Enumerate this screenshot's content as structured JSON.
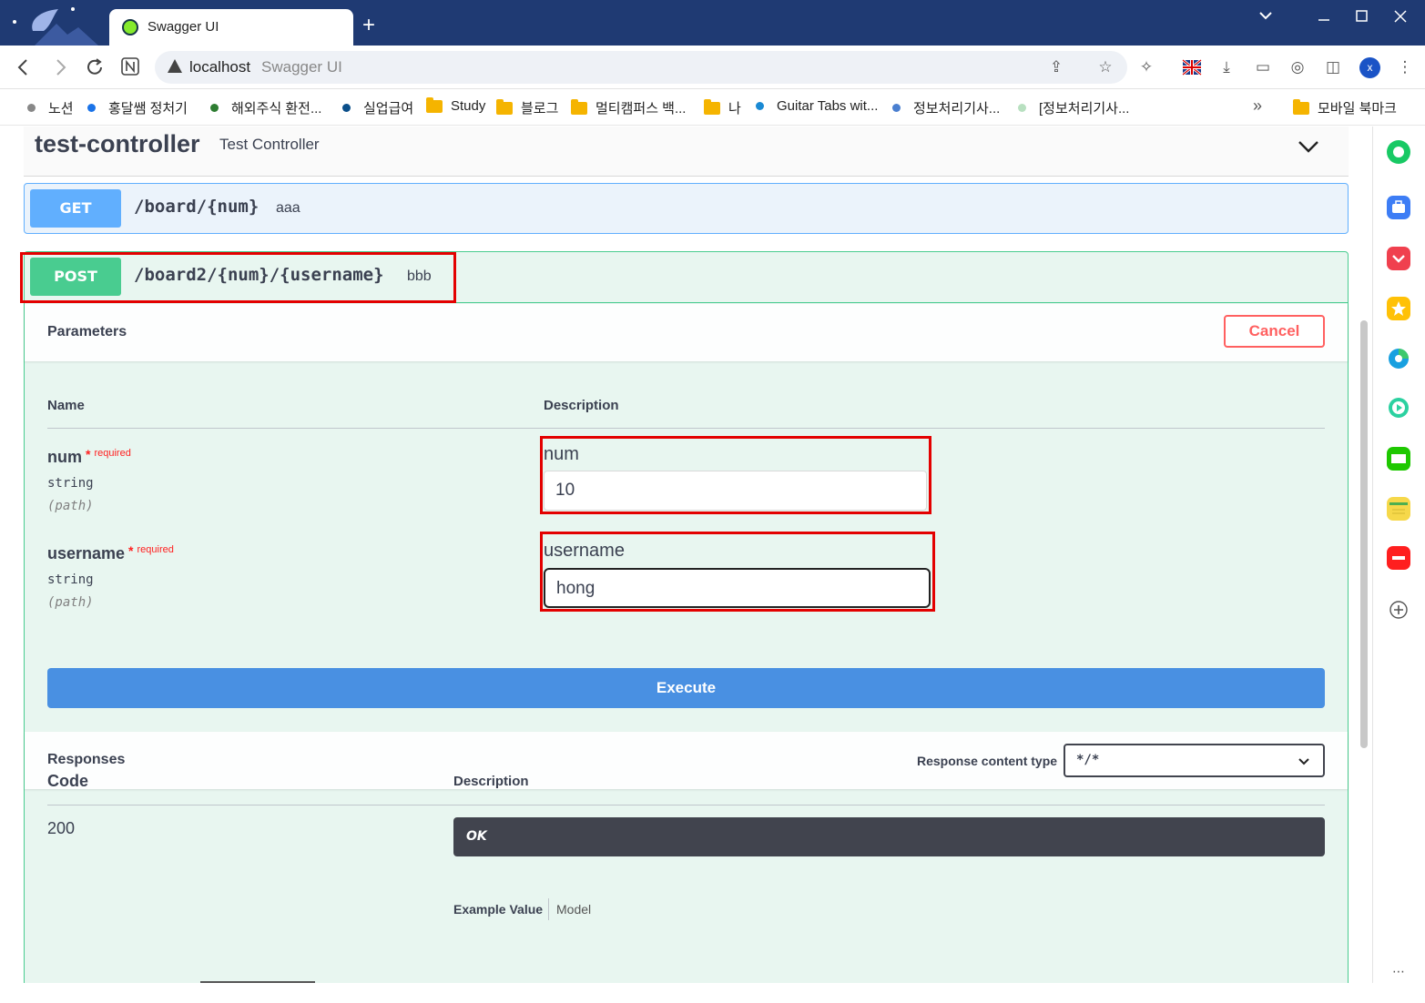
{
  "browser": {
    "tab_title": "Swagger UI",
    "new_tab": "+",
    "url_host": "localhost",
    "url_title": "Swagger UI",
    "profile_initial": "x"
  },
  "bookmarks": [
    {
      "label": "노션",
      "kind": "dot",
      "color": "#888888"
    },
    {
      "label": "홍달쌤 정처기",
      "kind": "dot",
      "color": "#1a73e8"
    },
    {
      "label": "해외주식 환전...",
      "kind": "dot",
      "color": "#2e7d32"
    },
    {
      "label": "실업급여",
      "kind": "dot",
      "color": "#0b4f8a"
    },
    {
      "label": "Study",
      "kind": "folder"
    },
    {
      "label": "블로그",
      "kind": "folder"
    },
    {
      "label": "멀티캠퍼스 백...",
      "kind": "folder"
    },
    {
      "label": "나",
      "kind": "folder"
    },
    {
      "label": "Guitar Tabs wit...",
      "kind": "dot",
      "color": "#1a8ad4"
    },
    {
      "label": "정보처리기사...",
      "kind": "dot",
      "color": "#4a7fd0"
    },
    {
      "label": "[정보처리기사...",
      "kind": "dot",
      "color": "#b8e0c0"
    }
  ],
  "bookmarks_more": "»",
  "mobile_bookmarks": "모바일 북마크",
  "controller": {
    "name": "test-controller",
    "description": "Test Controller"
  },
  "get_op": {
    "method": "GET",
    "path": "/board/{num}",
    "summary": "aaa"
  },
  "post_op": {
    "method": "POST",
    "path": "/board2/{num}/{username}",
    "summary": "bbb"
  },
  "parameters": {
    "title": "Parameters",
    "cancel": "Cancel",
    "col_name": "Name",
    "col_description": "Description",
    "required_mark": "*",
    "required_text": "required",
    "items": [
      {
        "name": "num",
        "type": "string",
        "in": "(path)",
        "label": "num",
        "value": "10"
      },
      {
        "name": "username",
        "type": "string",
        "in": "(path)",
        "label": "username",
        "value": "hong"
      }
    ]
  },
  "execute": "Execute",
  "responses": {
    "title": "Responses",
    "content_type_label": "Response content type",
    "content_type_value": "*/*",
    "col_code": "Code",
    "col_description": "Description",
    "code": "200",
    "description": "OK",
    "example_value": "Example Value",
    "model": "Model"
  }
}
